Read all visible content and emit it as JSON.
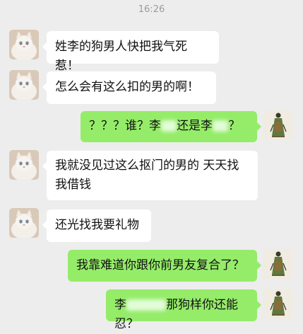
{
  "status_time": "16:26",
  "messages": [
    {
      "side": "left",
      "text": "姓李的狗男人快把我气死惹！"
    },
    {
      "side": "left",
      "text": "怎么会有这么扣的男的啊！"
    },
    {
      "side": "right",
      "parts": [
        "？？？谁？李",
        "还是李",
        "？"
      ]
    },
    {
      "side": "left",
      "lines": [
        "我就没见过这么抠门的男的 天天找",
        "我借钱"
      ]
    },
    {
      "side": "left",
      "text": "还光找我要礼物"
    },
    {
      "side": "right",
      "text": "我靠难道你跟你前男友复合了？"
    },
    {
      "side": "right",
      "parts": [
        "李",
        "那狗样你还能忍？"
      ]
    }
  ],
  "icons": {
    "left_avatar": "white-cat-avatar",
    "right_avatar": "ink-painting-figure-avatar"
  },
  "colors": {
    "background": "#ededed",
    "bubble_self": "#95ec69",
    "bubble_other": "#ffffff",
    "timestamp": "#9b9b9b"
  }
}
